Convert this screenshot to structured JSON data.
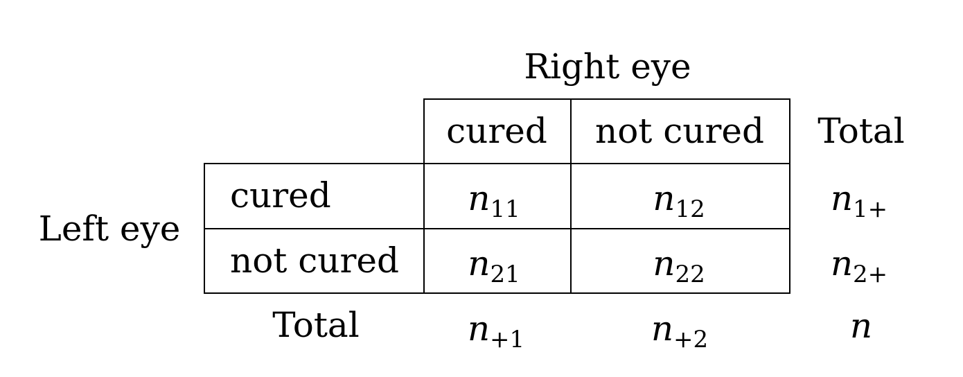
{
  "table": {
    "col_group_label": "Right eye",
    "row_group_label": "Left eye",
    "col_headers": [
      "cured",
      "not cured",
      "Total"
    ],
    "row_headers": [
      "cured",
      "not cured",
      "Total"
    ],
    "cells": {
      "r1c1": {
        "base": "n",
        "sub": "11"
      },
      "r1c2": {
        "base": "n",
        "sub": "12"
      },
      "r1tot": {
        "base": "n",
        "sub": "1+"
      },
      "r2c1": {
        "base": "n",
        "sub": "21"
      },
      "r2c2": {
        "base": "n",
        "sub": "22"
      },
      "r2tot": {
        "base": "n",
        "sub": "2+"
      },
      "tot_c1": {
        "base": "n",
        "sub": "+1"
      },
      "tot_c2": {
        "base": "n",
        "sub": "+2"
      },
      "grand_total": {
        "base": "n",
        "sub": ""
      }
    }
  }
}
